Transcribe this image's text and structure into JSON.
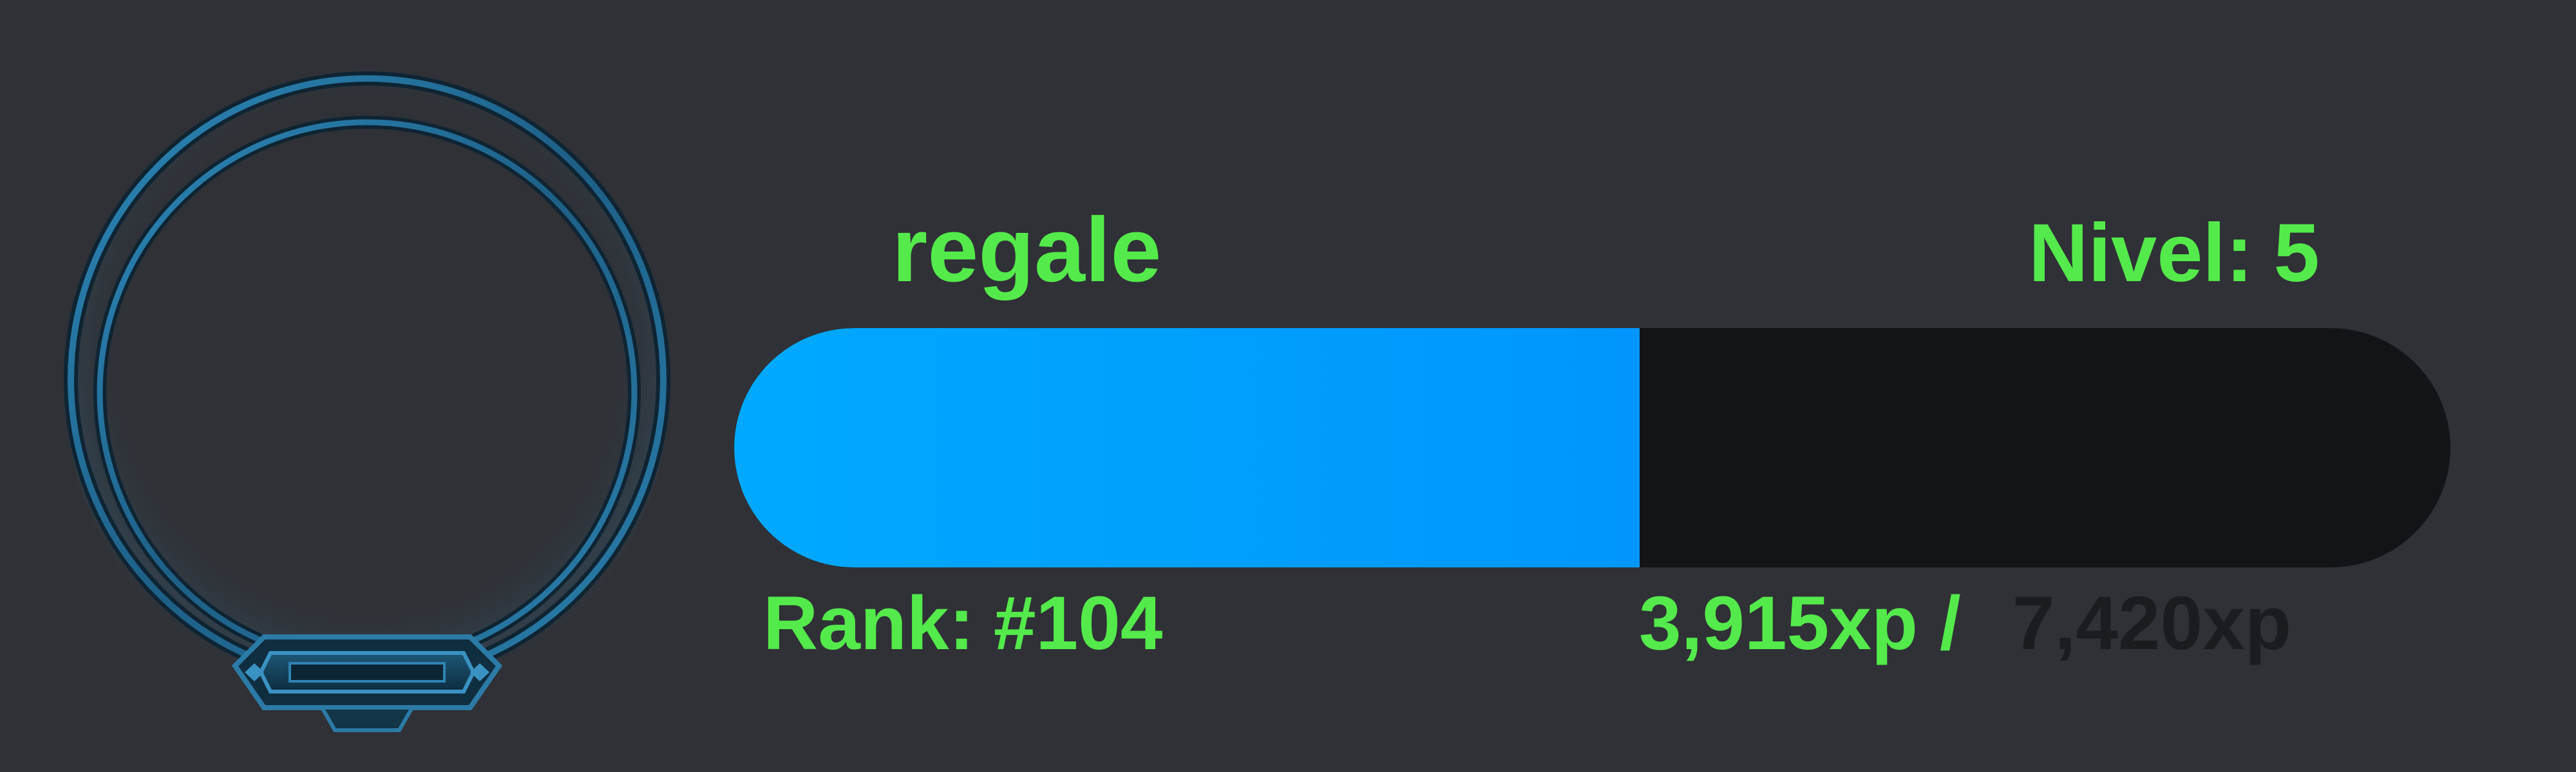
{
  "user": {
    "name": "regale"
  },
  "level": {
    "label": "Nivel:",
    "value": "5"
  },
  "rank": {
    "label": "Rank:",
    "value": "#104"
  },
  "xp": {
    "current": "3,915xp",
    "separator": "/",
    "total": "7,420xp",
    "progress_fraction": 0.5276
  },
  "colors": {
    "background": "#2f3136",
    "text_accent": "#54ea4b",
    "bar_fill": "#00a3ff",
    "bar_track": "#131417",
    "xp_total_text": "#1b1c20",
    "frame": "#2f7fae"
  },
  "icons": {
    "avatar_frame": "avatar-frame-icon"
  }
}
